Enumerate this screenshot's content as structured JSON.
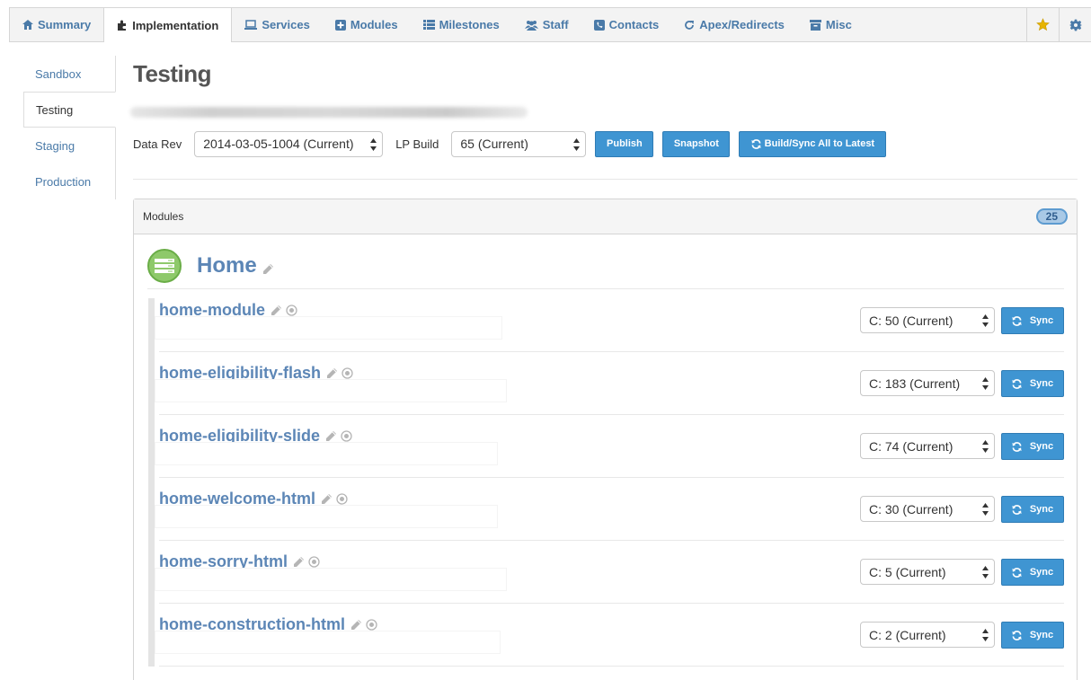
{
  "tabs": [
    {
      "label": "Summary",
      "icon": "home-icon",
      "active": false
    },
    {
      "label": "Implementation",
      "icon": "puzzle-icon",
      "active": true
    },
    {
      "label": "Services",
      "icon": "laptop-icon",
      "active": false
    },
    {
      "label": "Modules",
      "icon": "plus-square-icon",
      "active": false
    },
    {
      "label": "Milestones",
      "icon": "list-icon",
      "active": false
    },
    {
      "label": "Staff",
      "icon": "users-icon",
      "active": false
    },
    {
      "label": "Contacts",
      "icon": "phone-icon",
      "active": false
    },
    {
      "label": "Apex/Redirects",
      "icon": "redo-icon",
      "active": false
    },
    {
      "label": "Misc",
      "icon": "archive-icon",
      "active": false
    }
  ],
  "top_icons": {
    "star": "star-icon",
    "settings": "gear-icon"
  },
  "sidebar": {
    "items": [
      {
        "label": "Sandbox",
        "active": false
      },
      {
        "label": "Testing",
        "active": true
      },
      {
        "label": "Staging",
        "active": false
      },
      {
        "label": "Production",
        "active": false
      }
    ]
  },
  "page": {
    "title": "Testing"
  },
  "controls": {
    "data_rev_label": "Data Rev",
    "data_rev_value": "2014-03-05-1004 (Current)",
    "lp_build_label": "LP Build",
    "lp_build_value": "65 (Current)",
    "publish": "Publish",
    "snapshot": "Snapshot",
    "build_sync": "Build/Sync All to Latest"
  },
  "modules_panel": {
    "title": "Modules",
    "count": "25",
    "group_name": "Home",
    "modules": [
      {
        "name": "home-module",
        "version": "C: 50 (Current)",
        "sync": "Sync"
      },
      {
        "name": "home-eligibility-flash",
        "version": "C: 183 (Current)",
        "sync": "Sync"
      },
      {
        "name": "home-eligibility-slide",
        "version": "C: 74 (Current)",
        "sync": "Sync"
      },
      {
        "name": "home-welcome-html",
        "version": "C: 30 (Current)",
        "sync": "Sync"
      },
      {
        "name": "home-sorry-html",
        "version": "C: 5 (Current)",
        "sync": "Sync"
      },
      {
        "name": "home-construction-html",
        "version": "C: 2 (Current)",
        "sync": "Sync"
      }
    ]
  },
  "colors": {
    "link": "#5c86b6",
    "primary_button": "#3f95d2",
    "star": "#e7b400",
    "group_icon": "#8ec96a"
  }
}
